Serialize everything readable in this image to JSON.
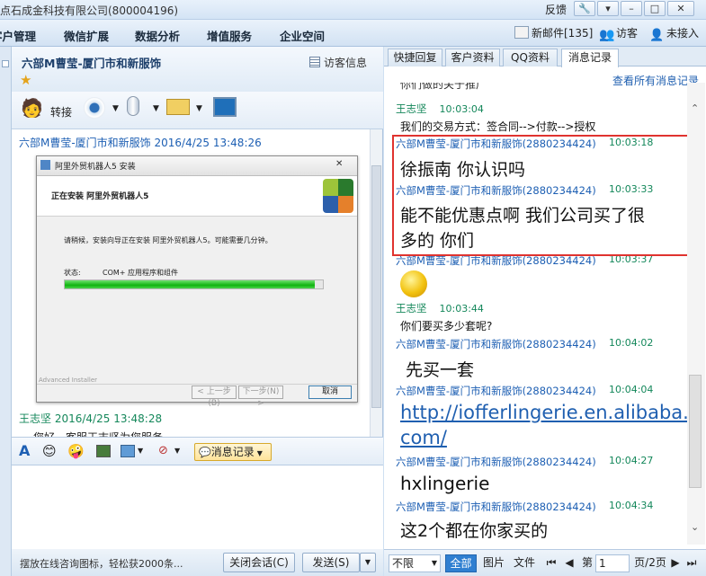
{
  "app": {
    "title": "点石成金科技有限公司(800004196)",
    "feedback": "反馈",
    "window_buttons": [
      "wrench",
      "menu",
      "minimize",
      "maximize",
      "close"
    ]
  },
  "menu": [
    "客户管理",
    "微信扩展",
    "数据分析",
    "增值服务",
    "企业空间"
  ],
  "status": {
    "mail": "新邮件[135]",
    "visitor": "访客",
    "unaccepted": "未接入"
  },
  "left": {
    "visitor_name": "六部M曹莹-厦门市和新服饰",
    "visitor_info": "访客信息",
    "transfer": "转接",
    "chat": [
      {
        "sender": "六部M曹莹-厦门市和新服饰",
        "time": "2016/4/25 13:48:26",
        "color": "#1d5fb3"
      },
      {
        "sender": "王志坚",
        "time": "2016/4/25 13:48:28",
        "color": "#14875a",
        "text": "您好，客服王志坚为您服务"
      }
    ],
    "installer": {
      "title": "阿里外贸机器人5 安装",
      "heading": "正在安装 阿里外贸机器人5",
      "message": "请稍候，安装向导正在安装 阿里外贸机器人5。可能需要几分钟。",
      "status_label": "状态:",
      "status_value": "COM+ 应用程序和组件",
      "progress": 0.97,
      "footer": "Advanced Installer",
      "back": "< 上一步(B)",
      "next": "下一步(N) >",
      "cancel": "取消"
    },
    "toolbar2": {
      "message_records": "消息记录"
    },
    "promo": "摆放在线咨询图标，轻松获2000条...",
    "close_session": "关闭会话(C)",
    "send": "发送(S)"
  },
  "right": {
    "tabs": [
      "快捷回复",
      "客户资料",
      "QQ资料",
      "消息记录"
    ],
    "active_tab": 3,
    "view_all": "查看所有消息记录",
    "messages": [
      {
        "text": "你们做的关于推广",
        "size": 12
      },
      {
        "name": "王志坚",
        "time": "10:03:04",
        "color": "#14875a",
        "text": "我们的交易方式：签合同-->付款-->授权",
        "size": 12
      },
      {
        "name": "六部M曹莹-厦门市和新服饰(2880234424)",
        "time": "10:03:18",
        "color": "#1d5fb3",
        "text": "徐振南 你认识吗",
        "size": 19
      },
      {
        "name": "六部M曹莹-厦门市和新服饰(2880234424)",
        "time": "10:03:33",
        "color": "#1d5fb3",
        "text": "能不能优惠点啊 我们公司买了很",
        "text2": "多的 你们",
        "size": 19
      },
      {
        "name": "六部M曹莹-厦门市和新服饰(2880234424)",
        "time": "10:03:37",
        "color": "#1d5fb3",
        "emoji": true
      },
      {
        "name": "王志坚",
        "time": "10:03:44",
        "color": "#14875a",
        "text": "你们要买多少套呢?",
        "size": 12
      },
      {
        "name": "六部M曹莹-厦门市和新服饰(2880234424)",
        "time": "10:04:02",
        "color": "#1d5fb3",
        "text": "先买一套",
        "size": 19
      },
      {
        "name": "六部M曹莹-厦门市和新服饰(2880234424)",
        "time": "10:04:04",
        "color": "#1d5fb3",
        "text": "http://iofferlingerie.en.alibaba.",
        "text2": "com/",
        "size": 21,
        "link": true
      },
      {
        "name": "六部M曹莹-厦门市和新服饰(2880234424)",
        "time": "10:04:27",
        "color": "#1d5fb3",
        "text": "hxlingerie",
        "size": 20
      },
      {
        "name": "六部M曹莹-厦门市和新服饰(2880234424)",
        "time": "10:04:34",
        "color": "#1d5fb3",
        "text": "这2个都在你家买的",
        "size": 19
      }
    ],
    "pager": {
      "range": "不限",
      "filters": [
        "全部",
        "图片",
        "文件"
      ],
      "page_label": "第",
      "page": "1",
      "total": "页/2页"
    }
  }
}
